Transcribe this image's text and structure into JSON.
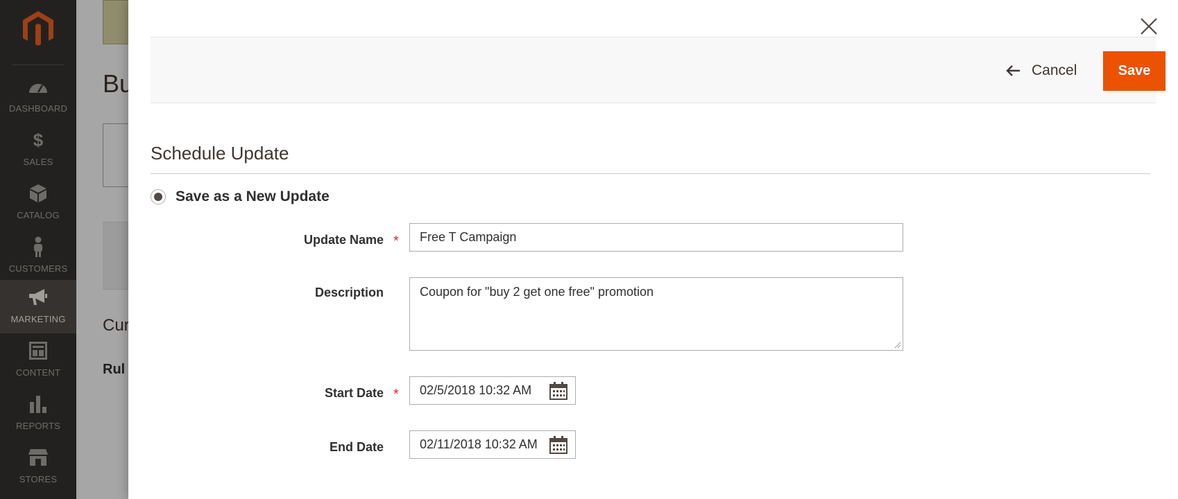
{
  "sidebar": {
    "items": [
      {
        "label": "DASHBOARD",
        "icon": "dashboard-icon"
      },
      {
        "label": "SALES",
        "icon": "dollar-icon"
      },
      {
        "label": "CATALOG",
        "icon": "box-icon"
      },
      {
        "label": "CUSTOMERS",
        "icon": "person-icon"
      },
      {
        "label": "MARKETING",
        "icon": "megaphone-icon",
        "active": true
      },
      {
        "label": "CONTENT",
        "icon": "layout-icon"
      },
      {
        "label": "REPORTS",
        "icon": "bar-chart-icon"
      },
      {
        "label": "STORES",
        "icon": "storefront-icon"
      }
    ]
  },
  "background": {
    "page_title": "Bu",
    "subheading": "Cur",
    "rule_label": "Rul"
  },
  "modal": {
    "cancel_label": "Cancel",
    "save_label": "Save",
    "section_title": "Schedule Update",
    "radio_label": "Save as a New Update",
    "fields": {
      "update_name": {
        "label": "Update Name",
        "value": "Free T Campaign",
        "required": true
      },
      "description": {
        "label": "Description",
        "value": "Coupon for \"buy 2 get one free\" promotion",
        "required": false
      },
      "start_date": {
        "label": "Start Date",
        "value": "02/5/2018 10:32 AM",
        "required": true
      },
      "end_date": {
        "label": "End Date",
        "value": "02/11/2018 10:32 AM",
        "required": false
      }
    },
    "required_mark": "*"
  },
  "colors": {
    "sidebar_bg": "#373330",
    "sidebar_active": "#524d49",
    "accent": "#eb5202",
    "required": "#e22626"
  }
}
